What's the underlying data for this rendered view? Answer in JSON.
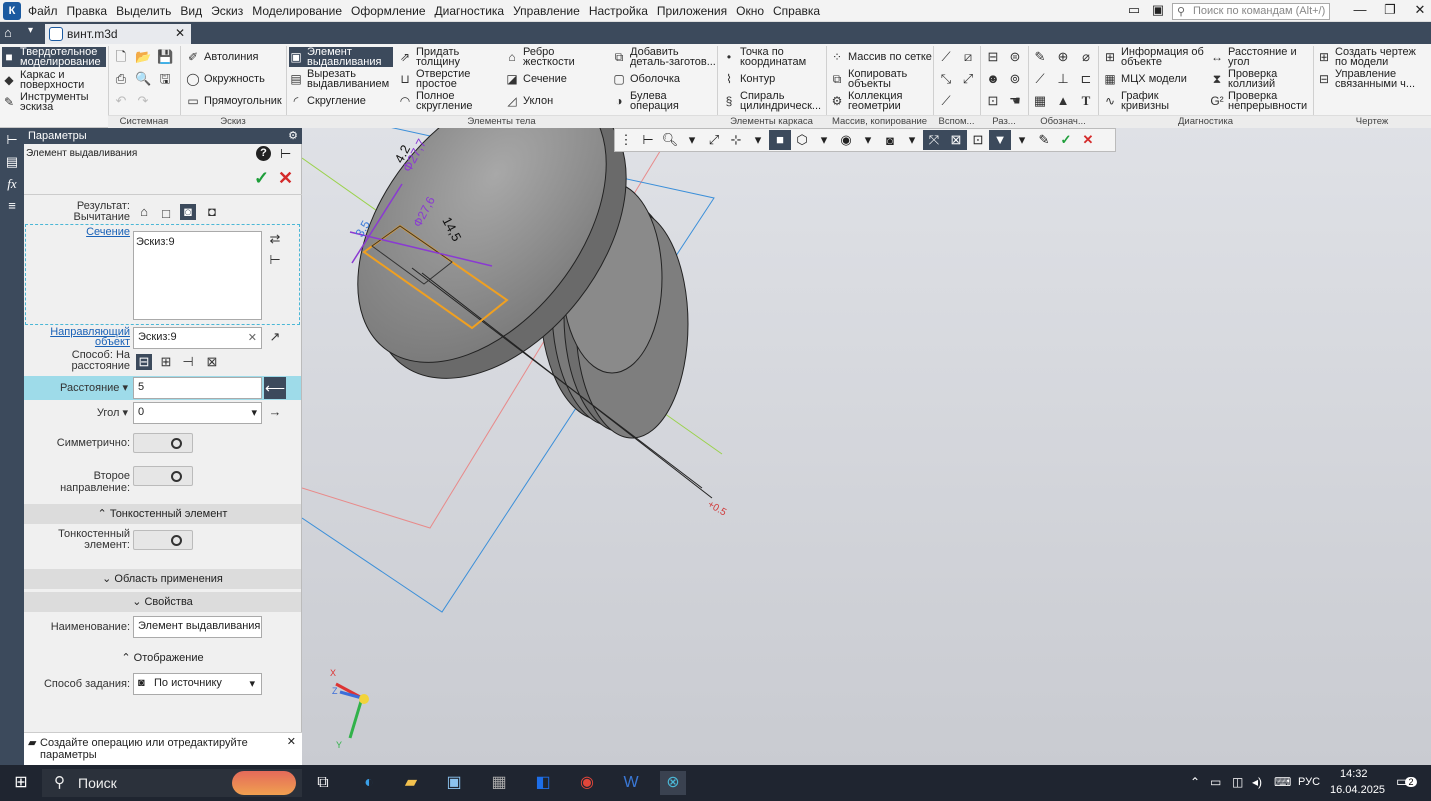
{
  "menu": [
    "Файл",
    "Правка",
    "Выделить",
    "Вид",
    "Эскиз",
    "Моделирование",
    "Оформление",
    "Диагностика",
    "Управление",
    "Настройка",
    "Приложения",
    "Окно",
    "Справка"
  ],
  "search_placeholder": "Поиск по командам (Alt+/)",
  "doc_tab": "винт.m3d",
  "ribbon": {
    "left_modes": [
      "Твердотельное моделирование",
      "Каркас и поверхности",
      "Инструменты эскиза"
    ],
    "sketch": [
      "Автолиния",
      "Окружность",
      "Прямоугольник"
    ],
    "body": [
      "Элемент выдавливания",
      "Вырезать выдавливанием",
      "Скругление"
    ],
    "body2": [
      "Придать толщину",
      "Отверстие простое",
      "Полное скругление"
    ],
    "body3": [
      "Ребро жесткости",
      "Сечение",
      "Уклон"
    ],
    "body4": [
      "Добавить деталь-заготов...",
      "Оболочка",
      "Булева операция"
    ],
    "frame": [
      "Точка по координатам",
      "Контур",
      "Спираль цилиндрическ..."
    ],
    "array": [
      "Массив по сетке",
      "Копировать объекты",
      "Коллекция геометрии"
    ],
    "diag": [
      "Информация об объекте",
      "МЦХ модели",
      "График кривизны"
    ],
    "diag2": [
      "Расстояние и угол",
      "Проверка коллизий",
      "Проверка непрерывности"
    ],
    "drawing": [
      "Создать чертеж по модели",
      "Управление связанными ч..."
    ],
    "groups": [
      "Системная",
      "Эскиз",
      "Элементы тела",
      "Элементы каркаса",
      "Массив, копирование",
      "Вспом...",
      "Раз...",
      "Обознач...",
      "Диагностика",
      "Чертеж"
    ]
  },
  "panel": {
    "title": "Параметры",
    "subtitle": "Элемент выдавливания",
    "result_label": "Результат: Вычитание",
    "section_label": "Сечение",
    "section_value": "Эскиз:9",
    "guide_label": "Направляющий объект",
    "guide_value": "Эскиз:9",
    "method_label": "Способ: На расстояние",
    "distance_label": "Расстояние",
    "distance_value": "5",
    "angle_label": "Угол",
    "angle_value": "0",
    "symmetric_label": "Симметрично:",
    "second_dir_label": "Второе направление:",
    "thin_section": "Тонкостенный элемент",
    "thin_label": "Тонкостенный элемент:",
    "scope_section": "Область применения",
    "props_section": "Свойства",
    "name_label": "Наименование:",
    "name_value": "Элемент выдавливания:",
    "display_section": "Отображение",
    "mode_label": "Способ задания:",
    "mode_value": "По источнику"
  },
  "status_message": "Создайте операцию или отредактируйте параметры",
  "dims": [
    "4.2",
    "Ф27,7",
    "14,5",
    "3.5",
    "Ф27,6",
    "+0.5"
  ],
  "taskbar": {
    "search": "Поиск",
    "lang": "РУС",
    "time": "14:32",
    "date": "16.04.2025",
    "notif": "2"
  }
}
